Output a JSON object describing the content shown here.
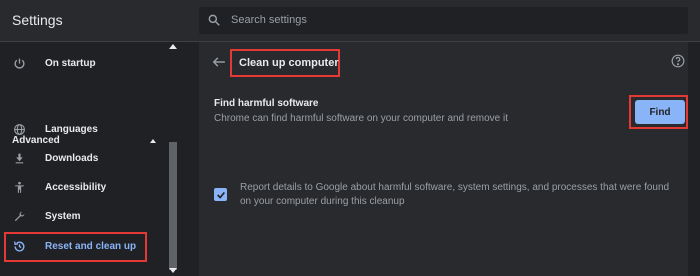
{
  "header": {
    "title": "Settings",
    "search_placeholder": "Search settings"
  },
  "sidebar": {
    "items": [
      {
        "label": "On startup",
        "icon": "power-icon"
      },
      {
        "label": "Languages",
        "icon": "globe-icon"
      },
      {
        "label": "Downloads",
        "icon": "download-icon"
      },
      {
        "label": "Accessibility",
        "icon": "accessibility-icon"
      },
      {
        "label": "System",
        "icon": "wrench-icon"
      },
      {
        "label": "Reset and clean up",
        "icon": "restore-icon"
      }
    ],
    "section_label": "Advanced"
  },
  "main": {
    "page_title": "Clean up computer",
    "find_title": "Find harmful software",
    "find_description": "Chrome can find harmful software on your computer and remove it",
    "find_button": "Find",
    "report_checkbox": {
      "checked": true,
      "label": "Report details to Google about harmful software, system settings, and processes that were found on your computer during this cleanup"
    }
  },
  "colors": {
    "accent": "#8ab4f8",
    "highlight": "#e53935",
    "background": "#202124",
    "panel": "#292a2d"
  }
}
